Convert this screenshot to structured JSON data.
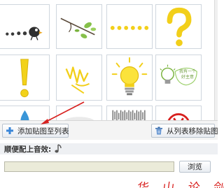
{
  "toolbar": {
    "add_label": "添加贴图至列表",
    "remove_label": "从列表移除贴图"
  },
  "music": {
    "label": "顺便配上音效:",
    "path_value": "",
    "browse_label": "浏览"
  },
  "annotation_text": "华 山 论 剑",
  "stickers": [
    {
      "icon": "ant-trail-icon"
    },
    {
      "icon": "leafy-branch-icon"
    },
    {
      "icon": "yellow-dots-icon"
    },
    {
      "icon": "question-mark-icon"
    },
    {
      "icon": "exclamation-mark-icon"
    },
    {
      "icon": "scribble-icon"
    },
    {
      "icon": "lightbulb-icon"
    },
    {
      "icon": "idea-bulb-icon",
      "text": "我有一个好主意"
    },
    {
      "icon": "water-drop-icon"
    },
    {
      "icon": "blur-icon"
    },
    {
      "icon": "glitch-icon"
    },
    {
      "icon": "red-stamp-icon"
    }
  ],
  "colors": {
    "accent_red": "#d8211f",
    "input_bg": "#ebebd9",
    "yellow": "#f2cf1a"
  }
}
